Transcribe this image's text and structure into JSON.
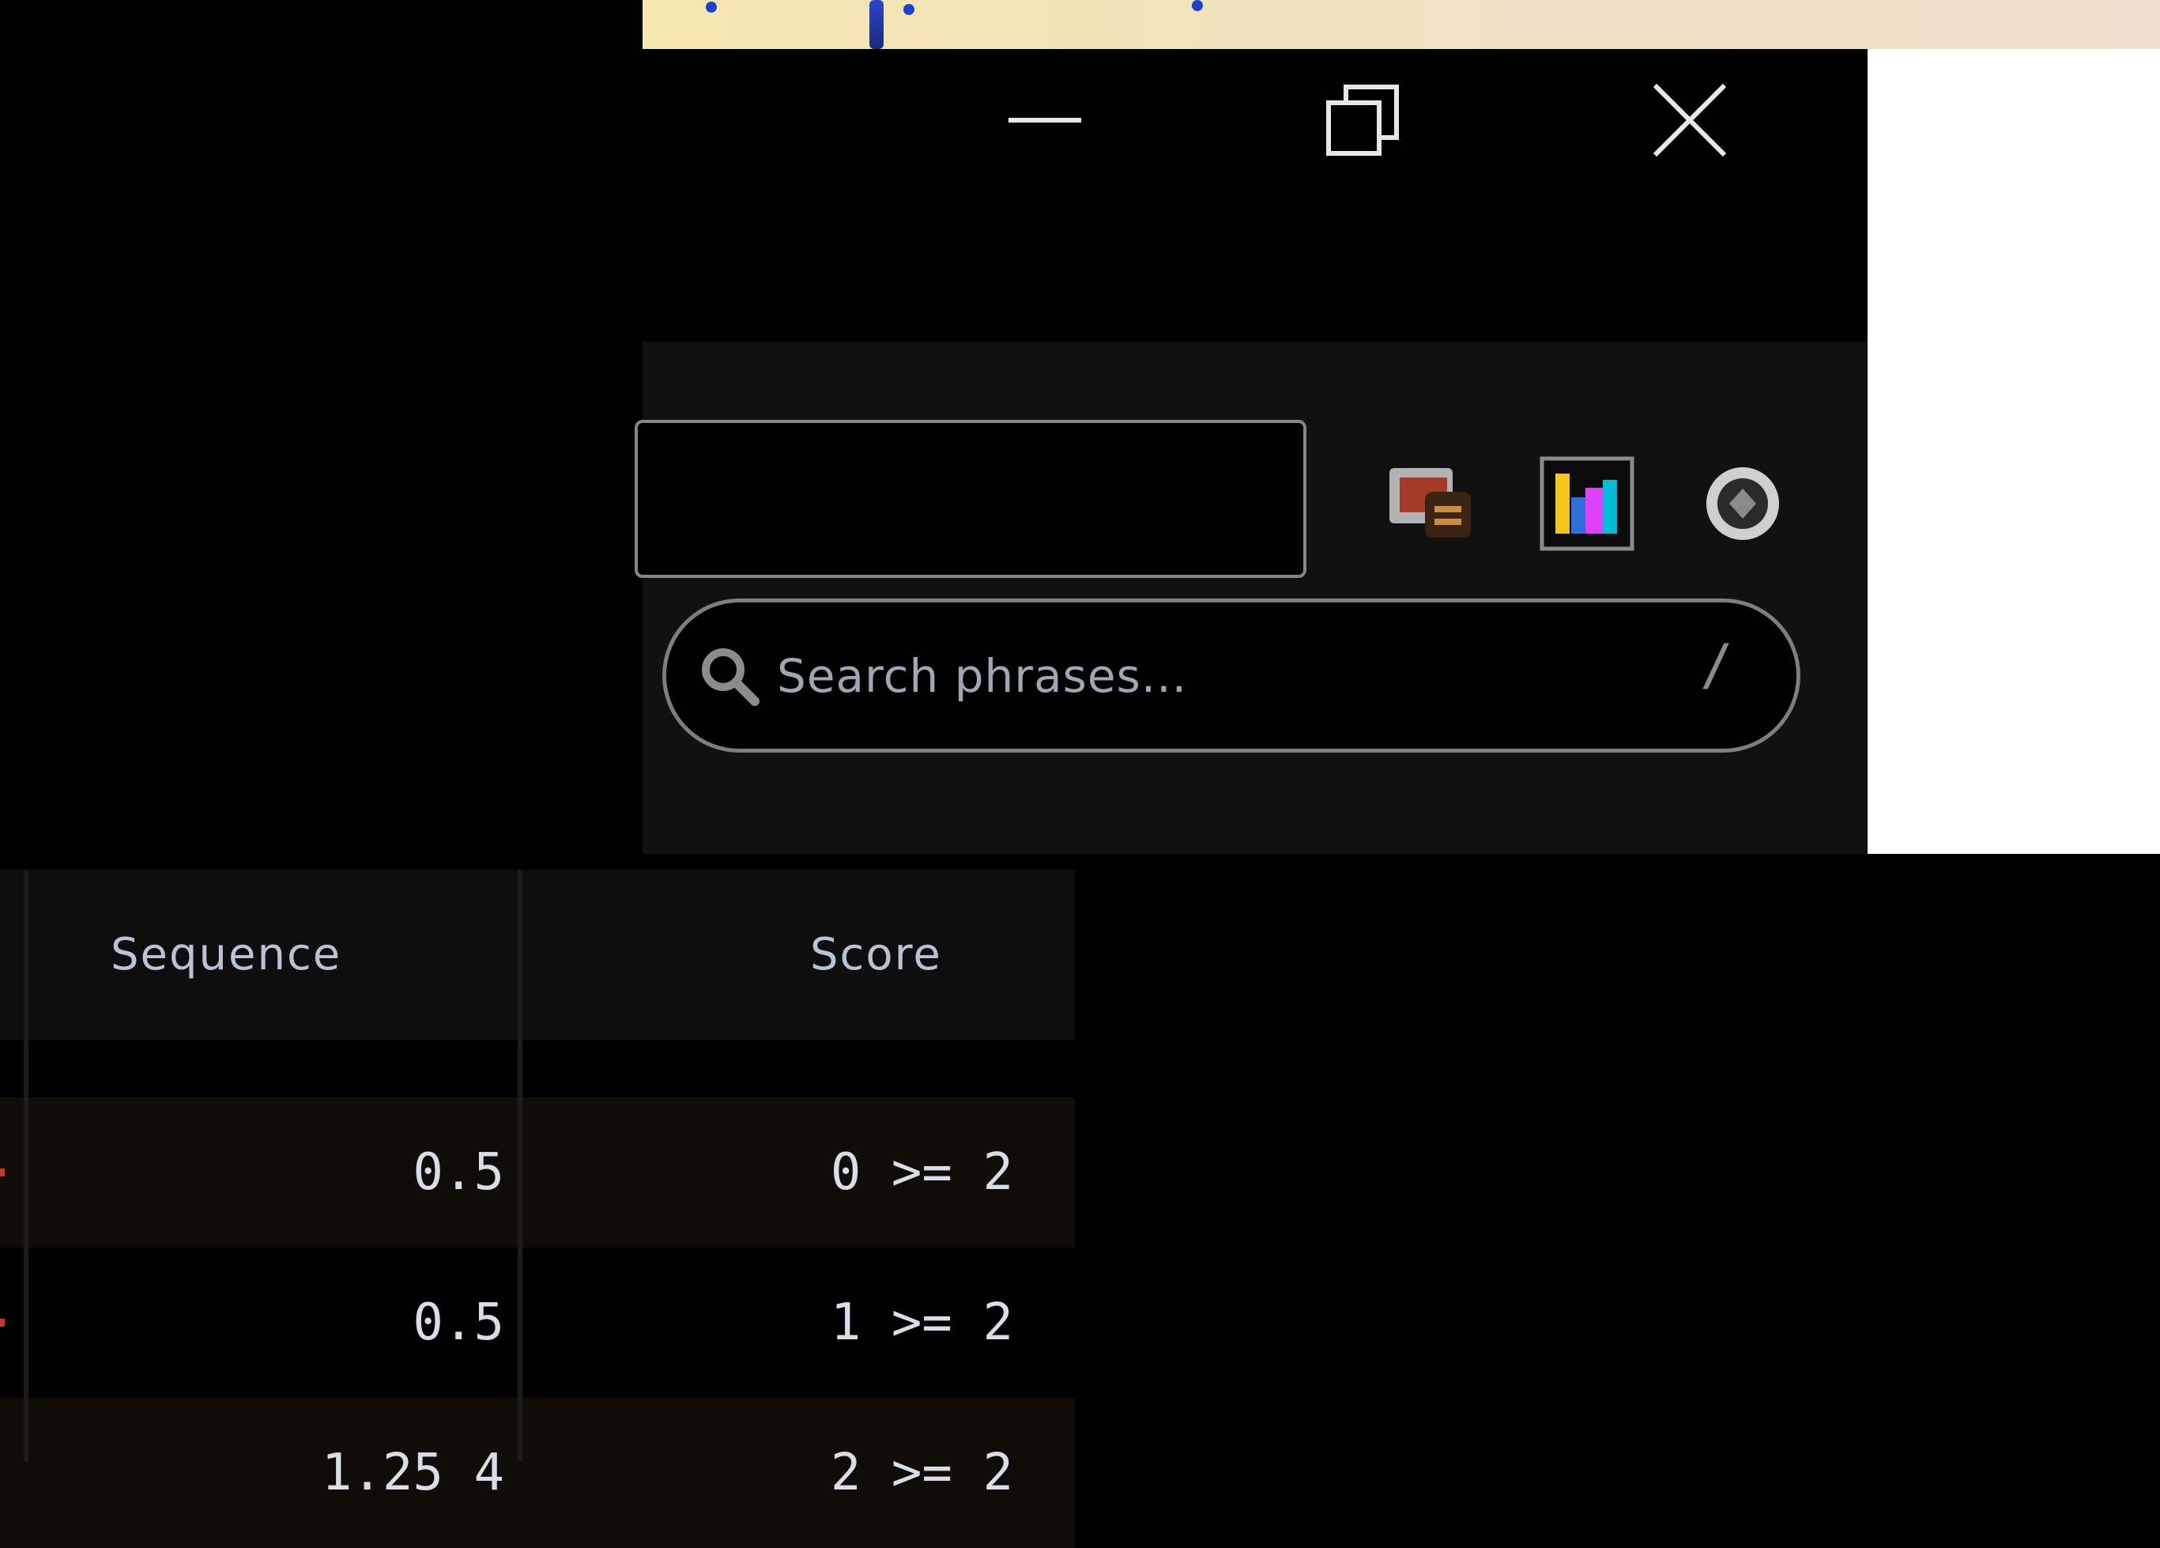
{
  "search": {
    "placeholder": "Search phrases...",
    "shortcut": "/"
  },
  "window_controls": {
    "minimize": "minimize",
    "restore": "restore",
    "close": "close"
  },
  "toolbar_icons": [
    "gallery-icon",
    "bar-chart-icon",
    "gear-icon"
  ],
  "table": {
    "columns": [
      "Sequence",
      "Score"
    ],
    "rows": [
      {
        "sequence": "0.5",
        "score": "0 >= 2"
      },
      {
        "sequence": "0.5",
        "score": "1 >= 2"
      },
      {
        "sequence": "1.25 4",
        "score": "2 >= 2"
      }
    ]
  },
  "colors": {
    "background": "#000000",
    "toolbar": "#111111",
    "border": "#8a8580",
    "accent_yellow": "#f5c518",
    "accent_magenta": "#e040fb",
    "accent_cyan": "#00bcd4"
  }
}
